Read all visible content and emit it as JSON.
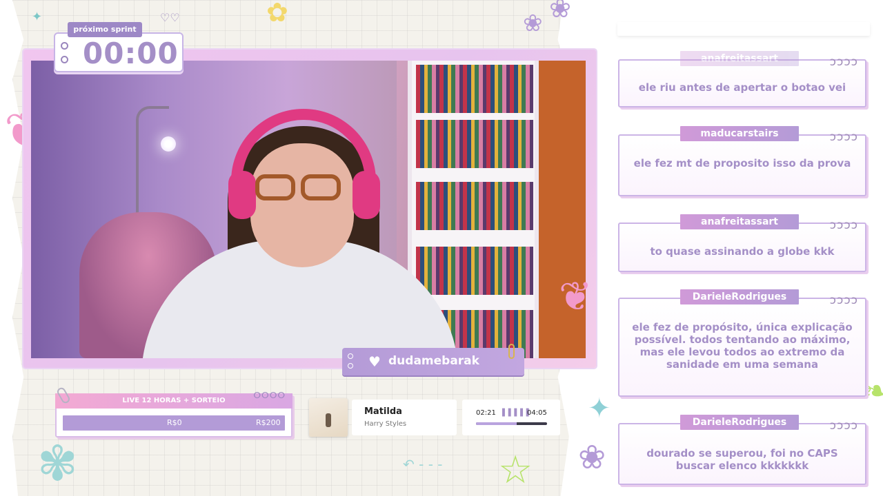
{
  "sprint": {
    "label": "próximo sprint",
    "time": "00:00"
  },
  "stream": {
    "streamer_name": "dudamebarak"
  },
  "goal": {
    "title": "LIVE 12 HORAS + SORTEIO",
    "current": "R$0",
    "target": "R$200",
    "progress": 0
  },
  "music": {
    "title": "Matilda",
    "artist": "Harry Styles",
    "elapsed": "02:21",
    "duration": "04:05",
    "progress": 0.575
  },
  "chat": {
    "messages": [
      {
        "user": "anafreitassart",
        "text": "ele riu antes de apertar o botao vei"
      },
      {
        "user": "maducarstairs",
        "text": "ele fez mt de proposito isso da prova"
      },
      {
        "user": "anafreitassart",
        "text": "to quase assinando a globe kkk"
      },
      {
        "user": "DarieleRodrigues",
        "text": "ele fez de propósito, única explicação possível. todos tentando ao máximo, mas ele levou todos ao extremo da sanidade em uma semana"
      },
      {
        "user": "DarieleRodrigues",
        "text": "dourado se superou, foi no CAPS buscar elenco kkkkkkk"
      }
    ]
  },
  "colors": {
    "accent": "#a48fc7",
    "pink": "#f3a9d3",
    "paper": "#f4f2ec"
  },
  "icons": {
    "heart": "heart-icon",
    "equalizer": "equalizer-icon",
    "paperclip": "paperclip-icon"
  }
}
